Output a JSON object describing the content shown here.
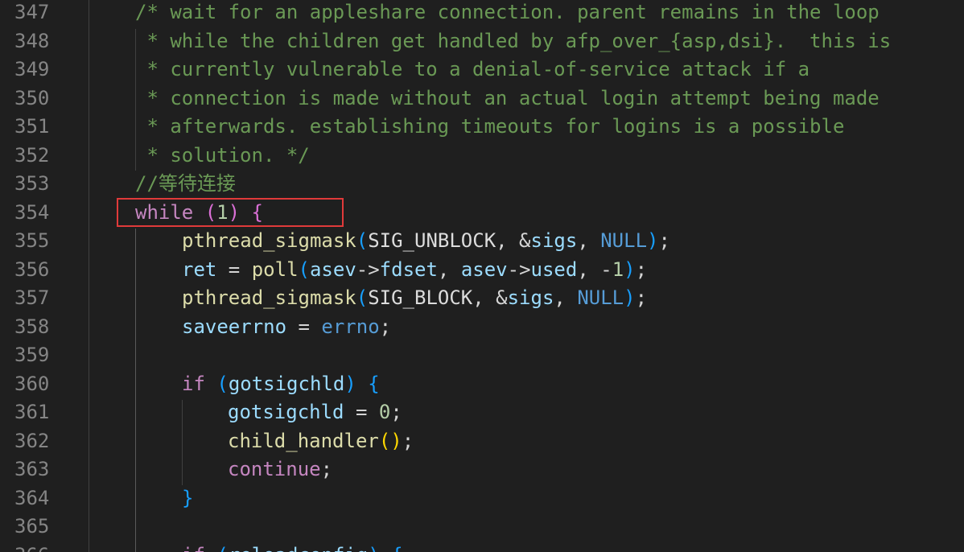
{
  "lines": [
    {
      "num": "347",
      "tokens": [
        {
          "t": "/* wait for an appleshare connection. parent remains in the loop",
          "c": "c-comment"
        }
      ]
    },
    {
      "num": "348",
      "tokens": [
        {
          "t": " * while the children get handled by afp_over_{asp,dsi}.  this is",
          "c": "c-comment"
        }
      ]
    },
    {
      "num": "349",
      "tokens": [
        {
          "t": " * currently vulnerable to a denial-of-service attack if a",
          "c": "c-comment"
        }
      ]
    },
    {
      "num": "350",
      "tokens": [
        {
          "t": " * connection is made without an actual login attempt being made",
          "c": "c-comment"
        }
      ]
    },
    {
      "num": "351",
      "tokens": [
        {
          "t": " * afterwards. establishing timeouts for logins is a possible",
          "c": "c-comment"
        }
      ]
    },
    {
      "num": "352",
      "tokens": [
        {
          "t": " * solution. */",
          "c": "c-comment"
        }
      ]
    },
    {
      "num": "353",
      "tokens": [
        {
          "t": "//等待连接",
          "c": "c-comment"
        }
      ]
    },
    {
      "num": "354",
      "tokens": [
        {
          "t": "while",
          "c": "c-keyword"
        },
        {
          "t": " ",
          "c": "c-punc"
        },
        {
          "t": "(",
          "c": "c-paren1"
        },
        {
          "t": "1",
          "c": "c-num"
        },
        {
          "t": ")",
          "c": "c-paren1"
        },
        {
          "t": " ",
          "c": "c-punc"
        },
        {
          "t": "{",
          "c": "c-paren1"
        }
      ]
    },
    {
      "num": "355",
      "tokens": [
        {
          "t": "pthread_sigmask",
          "c": "c-func"
        },
        {
          "t": "(",
          "c": "c-paren2"
        },
        {
          "t": "SIG_UNBLOCK",
          "c": "c-macro"
        },
        {
          "t": ", &",
          "c": "c-punc"
        },
        {
          "t": "sigs",
          "c": "c-var"
        },
        {
          "t": ", ",
          "c": "c-punc"
        },
        {
          "t": "NULL",
          "c": "c-const"
        },
        {
          "t": ")",
          "c": "c-paren2"
        },
        {
          "t": ";",
          "c": "c-punc"
        }
      ]
    },
    {
      "num": "356",
      "tokens": [
        {
          "t": "ret",
          "c": "c-var"
        },
        {
          "t": " = ",
          "c": "c-punc"
        },
        {
          "t": "poll",
          "c": "c-func"
        },
        {
          "t": "(",
          "c": "c-paren2"
        },
        {
          "t": "asev",
          "c": "c-var"
        },
        {
          "t": "->",
          "c": "c-punc"
        },
        {
          "t": "fdset",
          "c": "c-var"
        },
        {
          "t": ", ",
          "c": "c-punc"
        },
        {
          "t": "asev",
          "c": "c-var"
        },
        {
          "t": "->",
          "c": "c-punc"
        },
        {
          "t": "used",
          "c": "c-var"
        },
        {
          "t": ", -",
          "c": "c-punc"
        },
        {
          "t": "1",
          "c": "c-num"
        },
        {
          "t": ")",
          "c": "c-paren2"
        },
        {
          "t": ";",
          "c": "c-punc"
        }
      ]
    },
    {
      "num": "357",
      "tokens": [
        {
          "t": "pthread_sigmask",
          "c": "c-func"
        },
        {
          "t": "(",
          "c": "c-paren2"
        },
        {
          "t": "SIG_BLOCK",
          "c": "c-macro"
        },
        {
          "t": ", &",
          "c": "c-punc"
        },
        {
          "t": "sigs",
          "c": "c-var"
        },
        {
          "t": ", ",
          "c": "c-punc"
        },
        {
          "t": "NULL",
          "c": "c-const"
        },
        {
          "t": ")",
          "c": "c-paren2"
        },
        {
          "t": ";",
          "c": "c-punc"
        }
      ]
    },
    {
      "num": "358",
      "tokens": [
        {
          "t": "saveerrno",
          "c": "c-var"
        },
        {
          "t": " = ",
          "c": "c-punc"
        },
        {
          "t": "errno",
          "c": "c-const"
        },
        {
          "t": ";",
          "c": "c-punc"
        }
      ]
    },
    {
      "num": "359",
      "tokens": []
    },
    {
      "num": "360",
      "tokens": [
        {
          "t": "if",
          "c": "c-keyword"
        },
        {
          "t": " ",
          "c": "c-punc"
        },
        {
          "t": "(",
          "c": "c-paren2"
        },
        {
          "t": "gotsigchld",
          "c": "c-var"
        },
        {
          "t": ")",
          "c": "c-paren2"
        },
        {
          "t": " ",
          "c": "c-punc"
        },
        {
          "t": "{",
          "c": "c-paren2"
        }
      ]
    },
    {
      "num": "361",
      "tokens": [
        {
          "t": "gotsigchld",
          "c": "c-var"
        },
        {
          "t": " = ",
          "c": "c-punc"
        },
        {
          "t": "0",
          "c": "c-num"
        },
        {
          "t": ";",
          "c": "c-punc"
        }
      ]
    },
    {
      "num": "362",
      "tokens": [
        {
          "t": "child_handler",
          "c": "c-func"
        },
        {
          "t": "()",
          "c": "c-paren3"
        },
        {
          "t": ";",
          "c": "c-punc"
        }
      ]
    },
    {
      "num": "363",
      "tokens": [
        {
          "t": "continue",
          "c": "c-keyword"
        },
        {
          "t": ";",
          "c": "c-punc"
        }
      ]
    },
    {
      "num": "364",
      "tokens": [
        {
          "t": "}",
          "c": "c-paren2"
        }
      ]
    },
    {
      "num": "365",
      "tokens": []
    },
    {
      "num": "366",
      "tokens": [
        {
          "t": "if",
          "c": "c-keyword"
        },
        {
          "t": " ",
          "c": "c-punc"
        },
        {
          "t": "(",
          "c": "c-paren2"
        },
        {
          "t": "reloadconfig",
          "c": "c-var"
        },
        {
          "t": ")",
          "c": "c-paren2"
        },
        {
          "t": " ",
          "c": "c-punc"
        },
        {
          "t": "{",
          "c": "c-paren2"
        }
      ]
    }
  ],
  "colors": {
    "background": "#1f1f1f",
    "line_number": "#858585",
    "comment": "#6a9955",
    "keyword": "#c586c0",
    "function": "#dcdcaa",
    "variable": "#9cdcfe",
    "highlight_box": "#e03a3a"
  }
}
